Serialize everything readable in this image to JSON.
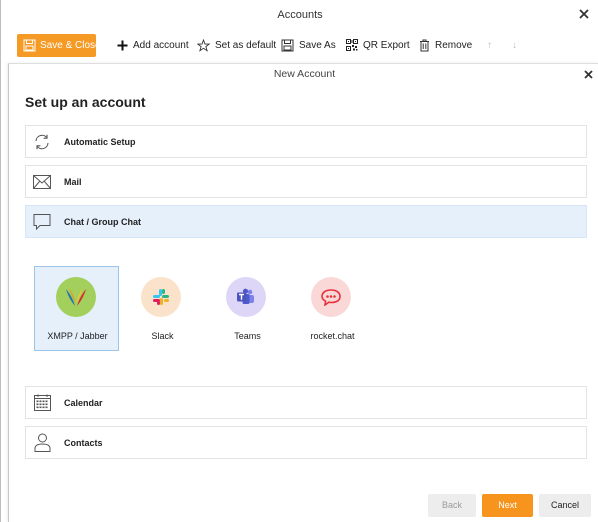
{
  "window": {
    "title": "Accounts"
  },
  "toolbar": {
    "save_close": "Save & Close",
    "add_account": "Add account",
    "set_default": "Set as default",
    "save_as": "Save As",
    "qr_export": "QR Export",
    "remove": "Remove",
    "move_up": "↑",
    "move_down": "↓"
  },
  "dialog": {
    "title": "New Account",
    "heading": "Set up an account",
    "rows": [
      {
        "label": "Automatic Setup",
        "icon": "sync-icon"
      },
      {
        "label": "Mail",
        "icon": "envelope-icon"
      },
      {
        "label": "Chat / Group Chat",
        "icon": "chat-bubble-icon",
        "selected": true
      },
      {
        "label": "Calendar",
        "icon": "calendar-icon"
      },
      {
        "label": "Contacts",
        "icon": "person-icon"
      }
    ],
    "providers": [
      {
        "label": "XMPP / Jabber",
        "icon": "xmpp-icon",
        "color": "#a3cf5c",
        "selected": true
      },
      {
        "label": "Slack",
        "icon": "slack-icon",
        "color": "#fbe3cb"
      },
      {
        "label": "Teams",
        "icon": "teams-icon",
        "color": "#ddd6f7"
      },
      {
        "label": "rocket.chat",
        "icon": "rocket-chat-icon",
        "color": "#fbd8d8"
      }
    ],
    "buttons": {
      "back": "Back",
      "next": "Next",
      "cancel": "Cancel"
    }
  },
  "colors": {
    "accent": "#f7941d",
    "selected_bg": "#e6f0fb",
    "selected_border": "#9fc4ea"
  }
}
